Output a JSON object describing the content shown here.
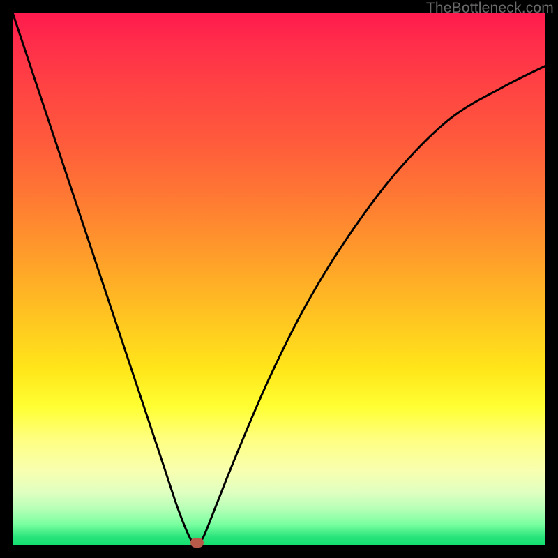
{
  "watermark": "TheBottleneck.com",
  "colors": {
    "curve": "#000000",
    "marker": "#b85a4a",
    "frame_bg": "#000000"
  },
  "chart_data": {
    "type": "line",
    "title": "",
    "xlabel": "",
    "ylabel": "",
    "xlim": [
      0,
      100
    ],
    "ylim": [
      0,
      100
    ],
    "grid": false,
    "legend": false,
    "notes": "V-shaped bottleneck curve on a vertical red-to-green heat gradient. No axis ticks or labels are visible in the image.",
    "series": [
      {
        "name": "bottleneck-curve",
        "x": [
          0,
          4,
          8,
          12,
          16,
          20,
          24,
          28,
          31,
          33,
          34,
          35,
          36,
          38,
          42,
          48,
          55,
          63,
          72,
          82,
          92,
          100
        ],
        "values": [
          100,
          88,
          76,
          64,
          52,
          40,
          28,
          16,
          7,
          2,
          0.5,
          0.5,
          2,
          7,
          17,
          31,
          45,
          58,
          70,
          80,
          86,
          90
        ]
      }
    ],
    "marker": {
      "x": 34.5,
      "y": 0.5
    }
  }
}
